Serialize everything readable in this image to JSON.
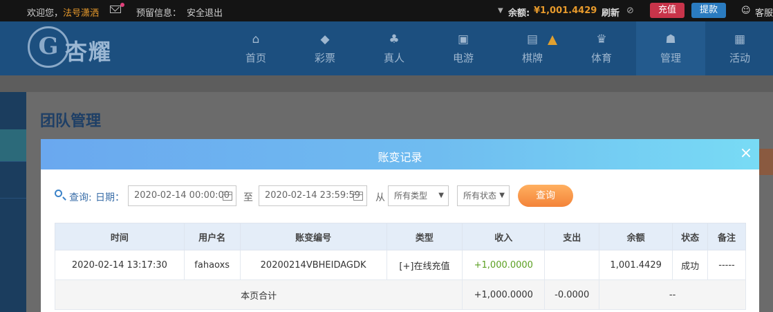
{
  "topbar": {
    "welcome": "欢迎您，",
    "username": "法号潇洒",
    "notice_label": "预留信息：",
    "logout": "安全退出",
    "balance_label": "余额:",
    "balance_value": "¥1,001.4429",
    "refresh": "刷新",
    "recharge": "充值",
    "withdraw": "提款",
    "service": "客服"
  },
  "brand": {
    "logo_text": "杏耀",
    "logo_letter": "G"
  },
  "nav": [
    {
      "label": "首页",
      "icon": "home-icon",
      "glyph": "⌂"
    },
    {
      "label": "彩票",
      "icon": "lottery-icon",
      "glyph": "◆"
    },
    {
      "label": "真人",
      "icon": "live-dealer-icon",
      "glyph": "♣"
    },
    {
      "label": "电游",
      "icon": "slot-game-icon",
      "glyph": "▣"
    },
    {
      "label": "棋牌",
      "icon": "card-game-icon",
      "glyph": "▤"
    },
    {
      "label": "体育",
      "icon": "trophy-icon",
      "glyph": "♛"
    },
    {
      "label": "管理",
      "icon": "management-icon",
      "glyph": "☗"
    },
    {
      "label": "活动",
      "icon": "gift-icon",
      "glyph": "▦"
    }
  ],
  "page": {
    "title": "团队管理"
  },
  "modal": {
    "title": "账变记录",
    "close": "×",
    "filter": {
      "query_label": "查询:",
      "date_label": "日期：",
      "start": "2020-02-14 00:00:00",
      "to": "至",
      "end": "2020-02-14 23:59:59",
      "from": "从",
      "type_select": "所有类型",
      "status_select": "所有状态",
      "button": "查询"
    },
    "table": {
      "headers": [
        "时间",
        "用户名",
        "账变编号",
        "类型",
        "收入",
        "支出",
        "余额",
        "状态",
        "备注"
      ],
      "rows": [
        [
          "2020-02-14 13:17:30",
          "fahaoxs",
          "20200214VBHEIDAGDK",
          "[+]在线充值",
          "+1,000.0000",
          "",
          "1,001.4429",
          "成功",
          "-----"
        ]
      ],
      "total": {
        "label": "本页合计",
        "income": "+1,000.0000",
        "expense": "-0.0000",
        "rest": "--"
      }
    }
  },
  "colors": {
    "accent": "#f38339",
    "nav_bg": "#1c4f7f",
    "income_green": "#5a9f20"
  }
}
